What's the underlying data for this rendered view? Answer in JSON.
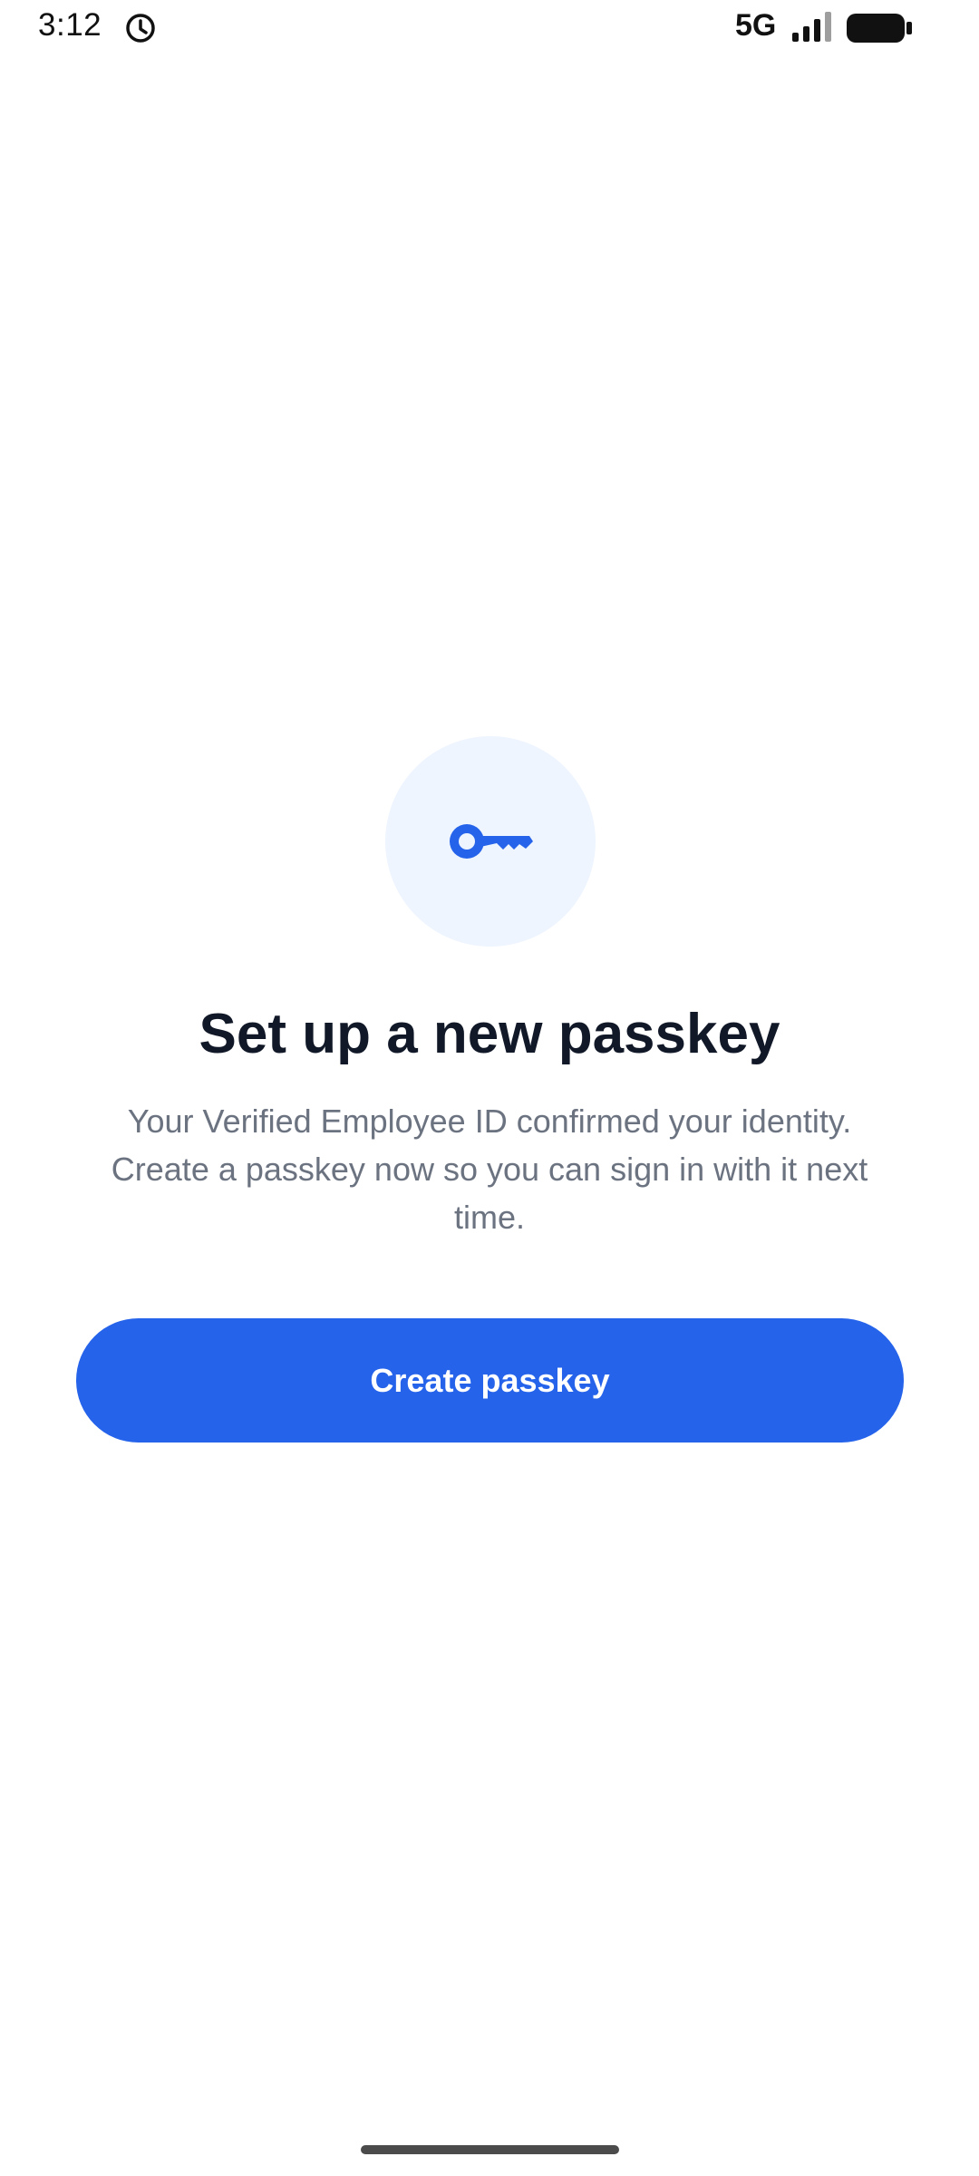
{
  "status_bar": {
    "time": "3:12",
    "network": "5G",
    "clock_icon": "alarm-clock-icon",
    "signal_icon": "signal-bars-icon",
    "battery_icon": "battery-full-icon"
  },
  "hero": {
    "icon": "key-icon",
    "icon_color": "#2563eb",
    "icon_background": "#eef5ff"
  },
  "content": {
    "title": "Set up a new passkey",
    "description": "Your Verified Employee ID confirmed your identity. Create a passkey now so you can sign in with it next time."
  },
  "actions": {
    "create_label": "Create passkey",
    "button_color": "#2563eb"
  }
}
